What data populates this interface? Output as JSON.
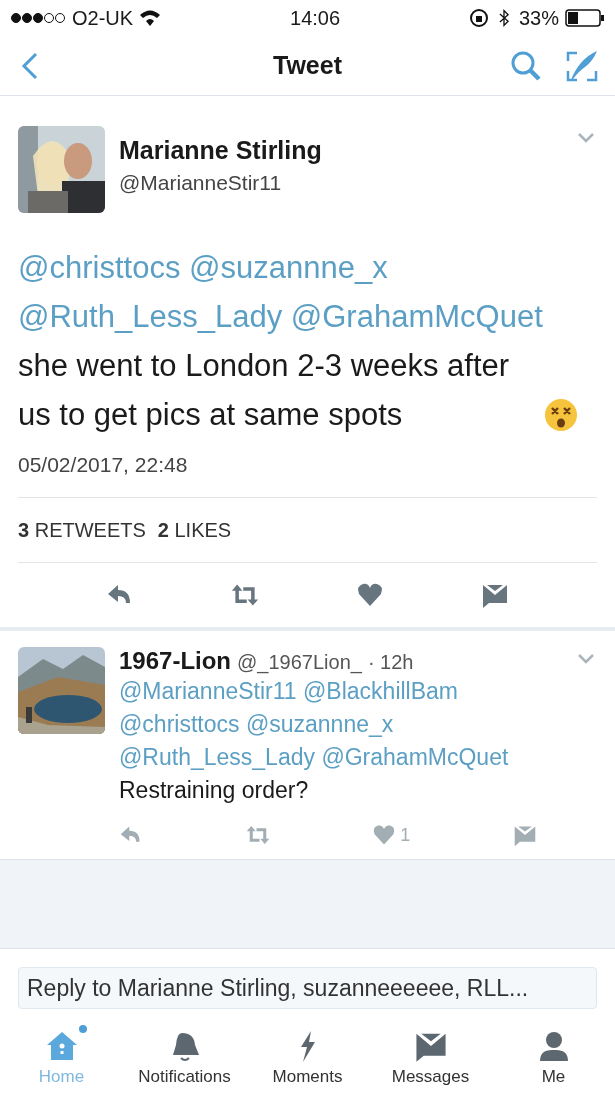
{
  "status_bar": {
    "carrier": "O2-UK",
    "time": "14:06",
    "battery": "33%"
  },
  "nav": {
    "title": "Tweet"
  },
  "tweet": {
    "name": "Marianne Stirling",
    "handle": "@MarianneStir11",
    "body": [
      {
        "kind": "mention",
        "text": "@christtocs"
      },
      {
        "kind": "mention",
        "text": "@suzannne_x"
      },
      {
        "kind": "mention",
        "text": "@Ruth_Less_Lady"
      },
      {
        "kind": "mention",
        "text": "@GrahamMcQuet"
      },
      {
        "kind": "text",
        "text": "she went to London 2-3 weeks after us to get pics at same spots"
      },
      {
        "kind": "emoji"
      }
    ],
    "date": "05/02/2017, 22:48",
    "stats": [
      "**3** RETWEETS",
      "**2** LIKES"
    ]
  },
  "replies": [
    {
      "name": "1967-Lion",
      "handle": "@_1967Lion_",
      "time": "· 12h",
      "body": [
        {
          "kind": "mention",
          "text": "@MarianneStir11"
        },
        {
          "kind": "mention",
          "text": "@BlackhillBam"
        },
        {
          "kind": "mention",
          "text": "@christtocs"
        },
        {
          "kind": "mention",
          "text": "@suzannne_x"
        },
        {
          "kind": "mention",
          "text": "@Ruth_Less_Lady"
        },
        {
          "kind": "mention",
          "text": "@GrahamMcQuet"
        },
        {
          "kind": "text",
          "text": "Restraining order?"
        }
      ],
      "likes": "1"
    }
  ],
  "reply_field": {
    "placeholder": "Reply to Marianne Stirling, suzanneeeeee, RLL..."
  },
  "tabs": [
    {
      "label": "Home",
      "kind": "home",
      "selected": true,
      "dot": true
    },
    {
      "label": "Notifications",
      "kind": "bell",
      "selected": false,
      "dot": false
    },
    {
      "label": "Moments",
      "kind": "bolt",
      "selected": false,
      "dot": false
    },
    {
      "label": "Messages",
      "kind": "mail",
      "selected": false,
      "dot": false
    },
    {
      "label": "Me",
      "kind": "person",
      "selected": false,
      "dot": false
    }
  ]
}
